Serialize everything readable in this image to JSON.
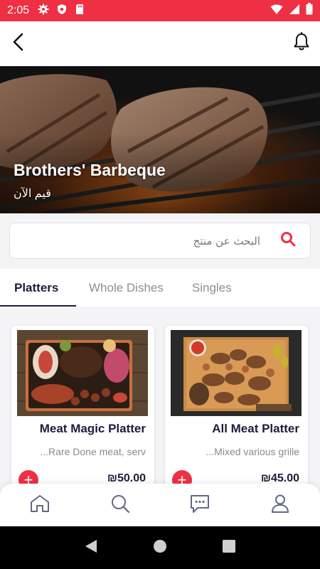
{
  "status_bar": {
    "time": "2:05",
    "background": "#ef2f44"
  },
  "header": {
    "back_icon": "back-arrow-icon",
    "notification_icon": "bell-icon"
  },
  "restaurant": {
    "name": "Brothers' Barbeque",
    "rate_label": "قيم الآن"
  },
  "search": {
    "placeholder": "البحث عن منتج",
    "icon": "search-icon",
    "icon_color": "#ef2f44"
  },
  "tabs": [
    {
      "label": "Platters",
      "active": true
    },
    {
      "label": "Whole Dishes",
      "active": false
    },
    {
      "label": "Singles",
      "active": false
    }
  ],
  "products": [
    {
      "name": "Meat Magic Platter",
      "description": "...Rare Done meat, serv",
      "price": "₪50.00"
    },
    {
      "name": "All Meat Platter",
      "description": "...Mixed various grille",
      "price": "₪45.00"
    }
  ],
  "bottom_nav": [
    {
      "icon": "home-icon"
    },
    {
      "icon": "search-icon"
    },
    {
      "icon": "chat-icon"
    },
    {
      "icon": "profile-icon"
    }
  ],
  "colors": {
    "accent": "#ef2f44",
    "text_dark": "#1d1d3a"
  }
}
